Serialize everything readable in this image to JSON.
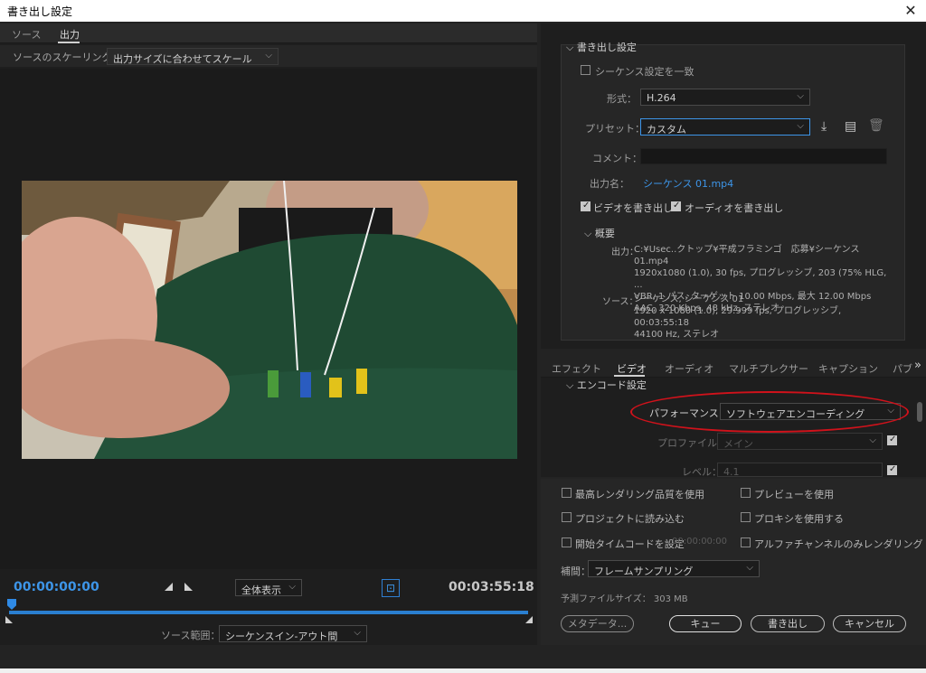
{
  "window": {
    "title": "書き出し設定",
    "close_symbol": "✕"
  },
  "left": {
    "tabs": [
      {
        "label": "ソース"
      },
      {
        "label": "出力"
      }
    ],
    "scaling_label": "ソースのスケーリング：",
    "scaling_value": "出力サイズに合わせてスケール",
    "timecode_start": "00:00:00:00",
    "timecode_end": "00:03:55:18",
    "zoom_value": "全体表示",
    "source_range_label": "ソース範囲：",
    "source_range_value": "シーケンスイン-アウト間"
  },
  "export": {
    "header": "書き出し設定",
    "match_sequence_label": "シーケンス設定を一致",
    "format_label": "形式：",
    "format_value": "H.264",
    "preset_label": "プリセット：",
    "preset_value": "カスタム",
    "comment_label": "コメント：",
    "comment_value": "",
    "output_name_label": "出力名：",
    "output_name_value": "シーケンス 01.mp4",
    "export_video_label": "ビデオを書き出し",
    "export_audio_label": "オーディオを書き出し",
    "summary_header": "概要",
    "summary_output_label": "出力：",
    "summary_output_lines": [
      "C:¥Usec..クトップ¥平成フラミンゴ　応募¥シーケンス 01.mp4",
      "1920x1080 (1.0), 30 fps, プログレッシブ, 203 (75% HLG, ...",
      "VBR, 1 パス, ターゲット 10.00 Mbps, 最大 12.00 Mbps",
      "AAC, 320 Kbps, 48 kHz, ステレオ"
    ],
    "summary_source_label": "ソース：",
    "summary_source_lines": [
      "シーケンス, シーケンス 01",
      "1920 x 1080 (1.0), 29.999 fps, プログレッシブ, 00:03:55:18",
      "44100 Hz, ステレオ"
    ]
  },
  "settings_tabs": [
    {
      "label": "エフェクト"
    },
    {
      "label": "ビデオ"
    },
    {
      "label": "オーディオ"
    },
    {
      "label": "マルチプレクサー"
    },
    {
      "label": "キャプション"
    },
    {
      "label": "パブ"
    }
  ],
  "more_tabs_symbol": "»",
  "encode": {
    "header": "エンコード設定",
    "performance_label": "パフォーマンス：",
    "performance_value": "ソフトウェアエンコーディング",
    "profile_label": "プロファイル：",
    "profile_value": "メイン",
    "level_label": "レベル：",
    "level_value": "4.1"
  },
  "options": {
    "max_render_quality": "最高レンダリング品質を使用",
    "use_previews": "プレビューを使用",
    "import_into_project": "プロジェクトに読み込む",
    "use_proxies": "プロキシを使用する",
    "set_start_timecode": "開始タイムコードを設定",
    "start_timecode_value": "00:00:00:00",
    "alpha_only": "アルファチャンネルのみレンダリング",
    "interpolation_label": "補間：",
    "interpolation_value": "フレームサンプリング",
    "file_size_label": "予測ファイルサイズ：",
    "file_size_value": "303 MB"
  },
  "buttons": {
    "metadata": "メタデータ...",
    "queue": "キュー",
    "export": "書き出し",
    "cancel": "キャンセル"
  },
  "colors": {
    "accent_blue": "#3d95e8",
    "annotation_red": "#d0121b"
  }
}
